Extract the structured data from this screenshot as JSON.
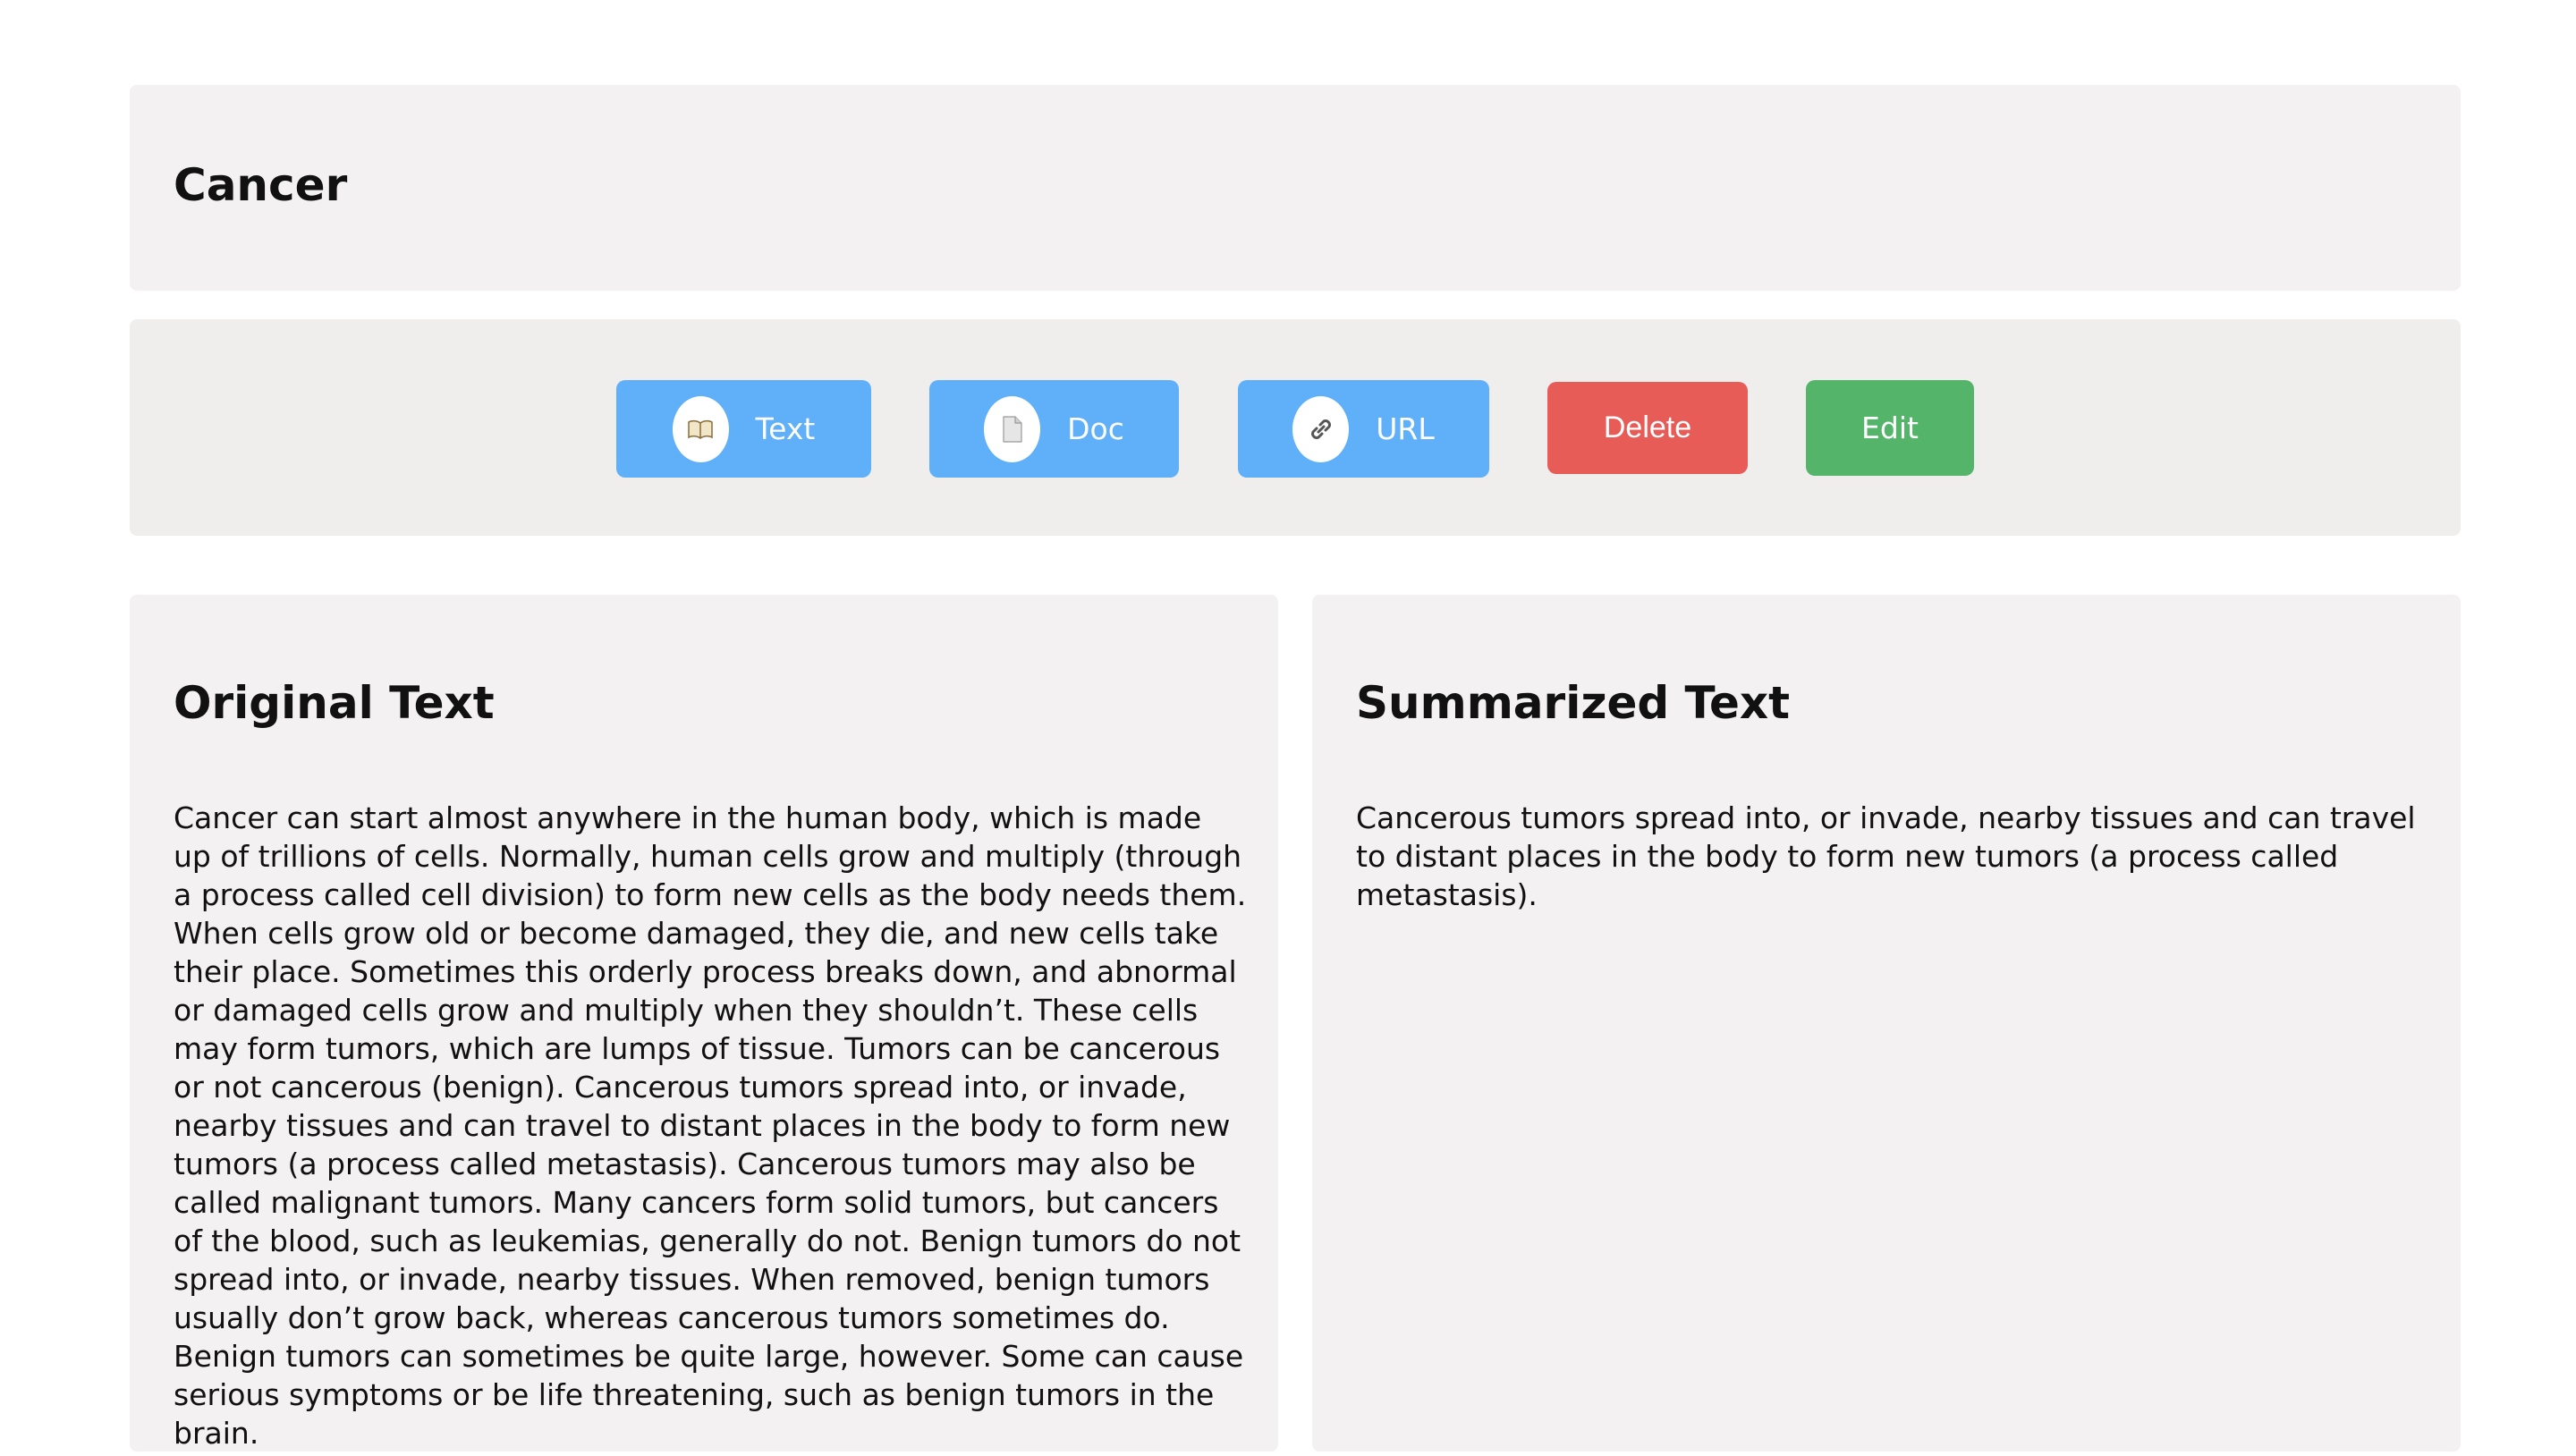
{
  "header": {
    "title": "Cancer"
  },
  "toolbar": {
    "buttons": {
      "text": {
        "label": "Text",
        "icon": "book-icon"
      },
      "doc": {
        "label": "Doc",
        "icon": "document-icon"
      },
      "url": {
        "label": "URL",
        "icon": "link-icon"
      },
      "delete": {
        "label": "Delete"
      },
      "edit": {
        "label": "Edit"
      }
    }
  },
  "colors": {
    "primary": "#5fb0f9",
    "danger": "#e85c58",
    "success": "#54b469",
    "card_bg": "#f3f1f2"
  },
  "original": {
    "title": "Original Text",
    "body": "Cancer can start almost anywhere in the human body, which is made up of trillions of cells. Normally, human cells grow and multiply (through a process called cell division) to form new cells as the body needs them. When cells grow old or become damaged, they die, and new cells take their place. Sometimes this orderly process breaks down, and abnormal or damaged cells grow and multiply when they shouldn’t. These cells may form tumors, which are lumps of tissue. Tumors can be cancerous or not cancerous (benign). Cancerous tumors spread into, or invade, nearby tissues and can travel to distant places in the body to form new tumors (a process called metastasis). Cancerous tumors may also be called malignant tumors. Many cancers form solid tumors, but cancers of the blood, such as leukemias, generally do not. Benign tumors do not spread into, or invade, nearby tissues. When removed, benign tumors usually don’t grow back, whereas cancerous tumors sometimes do. Benign tumors can sometimes be quite large, however. Some can cause serious symptoms or be life threatening, such as benign tumors in the brain."
  },
  "summary": {
    "title": "Summarized Text",
    "body": "Cancerous tumors spread into, or invade, nearby tissues and can travel to distant places in the body to form new tumors (a process called metastasis)."
  }
}
